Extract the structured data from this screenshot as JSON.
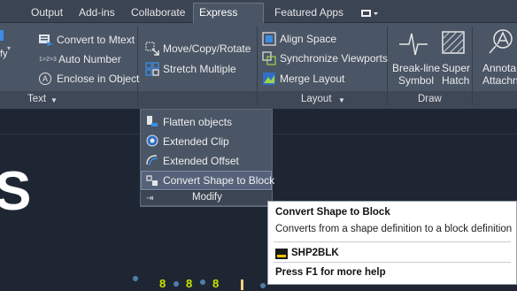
{
  "tabs": [
    "Output",
    "Add-ins",
    "Collaborate",
    "Express Tools",
    "Featured Apps"
  ],
  "active_tab": "Express Tools",
  "text_panel": {
    "items": [
      "Convert to Mtext",
      "Auto Number",
      "Enclose in Object"
    ],
    "auto_number_prefix": "1>2>3",
    "enclose_prefix": "A",
    "partial_left_labels": [
      "fy"
    ],
    "footer": "Text"
  },
  "modify_panel": {
    "items": [
      "Move/Copy/Rotate",
      "Stretch Multiple"
    ],
    "footer": "Modify",
    "dropdown_items": [
      "Flatten objects",
      "Extended Clip",
      "Extended Offset",
      "Convert Shape to Block"
    ],
    "highlighted_item": "Convert Shape to Block"
  },
  "layout_panel": {
    "items": [
      "Align Space",
      "Synchronize Viewports",
      "Merge Layout"
    ],
    "footer": "Layout"
  },
  "draw_panel": {
    "items": [
      {
        "line1": "Break-line",
        "line2": "Symbol"
      },
      {
        "line1": "Super",
        "line2": "Hatch"
      }
    ],
    "footer": "Draw"
  },
  "annot_panel": {
    "line1": "Annota",
    "line2": "Attachn"
  },
  "canvas": {
    "big_letter": "S",
    "marks": [
      "8",
      "8",
      "8"
    ]
  },
  "tooltip": {
    "title": "Convert Shape to Block",
    "description": "Converts from a shape definition to a block definition",
    "command": "SHP2BLK",
    "help": "Press F1 for more help"
  },
  "colors": {
    "ribbon_bg": "#4a5565",
    "tab_bar_bg": "#3b4453",
    "canvas_bg": "#1f2633",
    "highlight": "#56627a",
    "tooltip_bg": "#ffffff",
    "accent_blue": "#3a8ee6",
    "accent_green": "#c8e600"
  }
}
